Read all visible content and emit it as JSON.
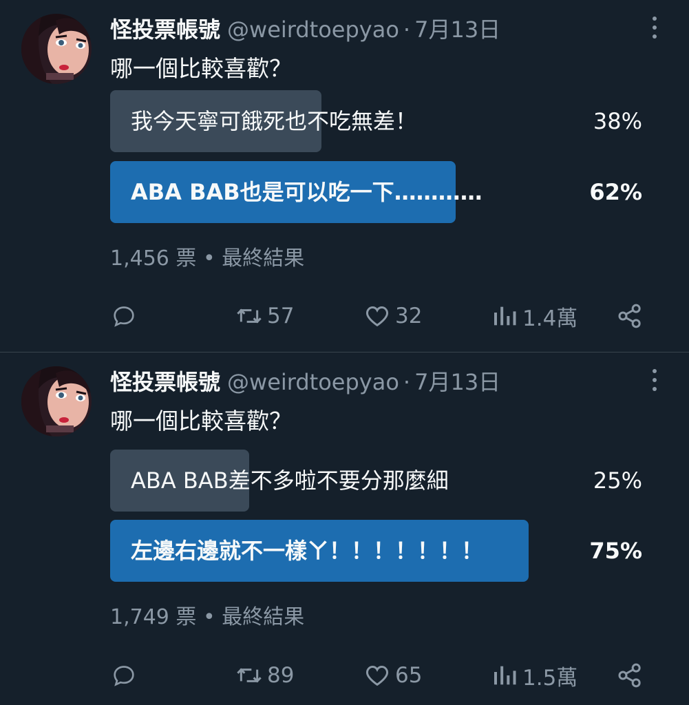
{
  "tweets": [
    {
      "author": "怪投票帳號",
      "handle": "@weirdtoepyao",
      "separator": "·",
      "date": "7月13日",
      "question": "哪一個比較喜歡？",
      "options": [
        {
          "label": "我今天寧可餓死也不吃無差！",
          "percent": "38%",
          "fraction": 0.38,
          "winner": false
        },
        {
          "label": "ABA BAB也是可以吃一下…………",
          "percent": "62%",
          "fraction": 0.62,
          "winner": true
        }
      ],
      "votes": "1,456 票",
      "status": "最終結果",
      "reply_count": "",
      "retweet_count": "57",
      "like_count": "32",
      "view_count": "1.4萬"
    },
    {
      "author": "怪投票帳號",
      "handle": "@weirdtoepyao",
      "separator": "·",
      "date": "7月13日",
      "question": "哪一個比較喜歡？",
      "options": [
        {
          "label": "ABA BAB差不多啦不要分那麼細",
          "percent": "25%",
          "fraction": 0.25,
          "winner": false
        },
        {
          "label": "左邊右邊就不一樣ㄚ！！！！！！！",
          "percent": "75%",
          "fraction": 0.75,
          "winner": true
        }
      ],
      "votes": "1,749 票",
      "status": "最終結果",
      "reply_count": "",
      "retweet_count": "89",
      "like_count": "65",
      "view_count": "1.5萬"
    }
  ],
  "icons": {
    "reply": "reply-icon",
    "retweet": "retweet-icon",
    "like": "heart-icon",
    "views": "views-icon",
    "share": "share-icon",
    "more": "more-icon"
  },
  "colors": {
    "background": "#15202b",
    "winner_bar": "#1d6db0",
    "loser_bar": "#3b4a59",
    "secondary_text": "#8b98a5"
  }
}
